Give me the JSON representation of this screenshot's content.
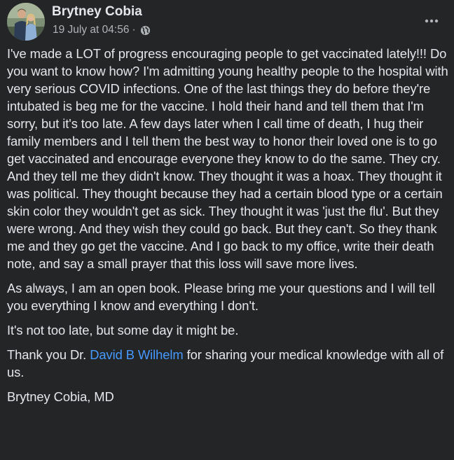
{
  "post": {
    "author": "Brytney Cobia",
    "timestamp": "19 July at 04:56",
    "separator": "·",
    "privacy_icon": "globe-icon",
    "more_icon": "more-options-icon",
    "paragraphs": [
      "I've made a LOT of progress encouraging people to get vaccinated lately!!! Do you want to know how? I'm admitting young healthy people to the hospital with very serious COVID infections. One of the last things they do before they're intubated is beg me for the vaccine. I hold their hand and tell them that I'm sorry, but it's too late. A few days later when I call time of death, I hug their family members and I tell them the best way to honor their loved one is to go get vaccinated and encourage everyone they know to do the same. They cry. And they tell me they didn't know. They thought it was a hoax. They thought it was political. They thought because they had a certain blood type or a certain skin color they wouldn't get as sick. They thought it was 'just the flu'. But they were wrong. And they wish they could go back. But they can't. So they thank me and they go get the vaccine. And I go back to my office, write their death note, and say a small prayer that this loss will save more lives.",
      "As always, I am an open book. Please bring me your questions and I will tell you everything I know and everything I don't.",
      "It's not too late, but some day it might be."
    ],
    "thanks": {
      "before": "Thank you Dr. ",
      "link": "David B Wilhelm",
      "after": " for sharing your medical knowledge with all of us."
    },
    "signature": "Brytney Cobia, MD"
  },
  "colors": {
    "background": "#242526",
    "text": "#e4e6eb",
    "secondary_text": "#b0b3b8",
    "link": "#4599ff"
  }
}
